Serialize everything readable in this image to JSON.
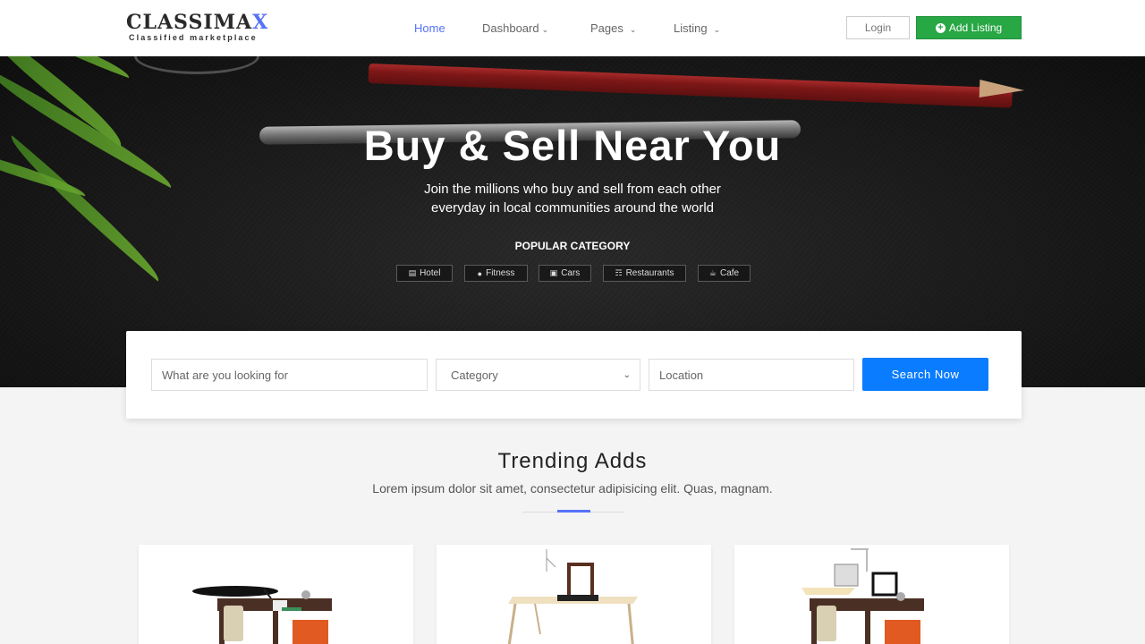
{
  "brand": {
    "name_main": "CLASSIMA",
    "name_accent": "X",
    "tagline": "Classified marketplace"
  },
  "nav": {
    "items": [
      {
        "label": "Home",
        "active": true,
        "dropdown": false
      },
      {
        "label": "Dashboard",
        "active": false,
        "dropdown": true
      },
      {
        "label": "Pages",
        "active": false,
        "dropdown": true
      },
      {
        "label": "Listing",
        "active": false,
        "dropdown": true
      }
    ],
    "login_label": "Login",
    "add_listing_label": "Add Listing"
  },
  "hero": {
    "title": "Buy & Sell Near You",
    "subtitle_line1": "Join the millions who buy and sell from each other",
    "subtitle_line2": "everyday in local communities around the world",
    "popular_label": "POPULAR CATEGORY",
    "categories": [
      {
        "label": "Hotel",
        "icon": "bed-icon"
      },
      {
        "label": "Fitness",
        "icon": "ball-icon"
      },
      {
        "label": "Cars",
        "icon": "car-icon"
      },
      {
        "label": "Restaurants",
        "icon": "cutlery-icon"
      },
      {
        "label": "Cafe",
        "icon": "coffee-icon"
      }
    ]
  },
  "search": {
    "keyword_placeholder": "What are you looking for",
    "category_value": "Category",
    "location_placeholder": "Location",
    "button_label": "Search Now"
  },
  "trending": {
    "title": "Trending Adds",
    "subtitle": "Lorem ipsum dolor sit amet, consectetur adipisicing elit. Quas, magnam."
  },
  "colors": {
    "accent": "#5672f9",
    "add_listing_green": "#28a745",
    "search_blue": "#0a7cff"
  }
}
